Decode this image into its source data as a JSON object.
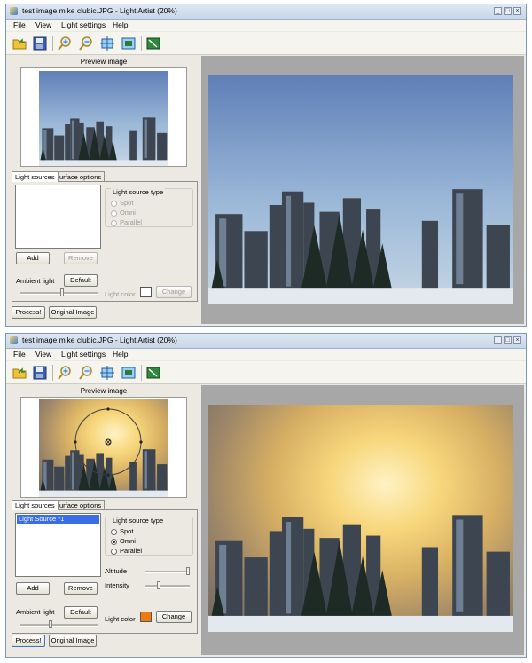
{
  "window1": {
    "title": "test image mike clubic.JPG - Light Artist (20%)",
    "menu": [
      "File",
      "View",
      "Light settings",
      "Help"
    ],
    "preview_label": "Preview image",
    "tabs": [
      "Light sources",
      "Surface options"
    ],
    "add_label": "Add",
    "remove_label": "Remove",
    "ambient_label": "Ambient light",
    "default_label": "Default",
    "ambient_level": 0.55,
    "light_type_title": "Light source type",
    "light_types": [
      "Spot",
      "Omni",
      "Parallel"
    ],
    "light_color_label": "Light color",
    "change_label": "Change",
    "light_color": "#ffffff",
    "process_label": "Process!",
    "original_label": "Original Image"
  },
  "window2": {
    "title": "test image mike clubic.JPG - Light Artist (20%)",
    "menu": [
      "File",
      "View",
      "Light settings",
      "Help"
    ],
    "preview_label": "Preview image",
    "tabs": [
      "Light sources",
      "Surface options"
    ],
    "list_item": "Light Source *1",
    "add_label": "Add",
    "remove_label": "Remove",
    "ambient_label": "Ambient light",
    "default_label": "Default",
    "ambient_level": 0.4,
    "light_type_title": "Light source type",
    "light_types": [
      "Spot",
      "Omni",
      "Parallel"
    ],
    "selected_type": "Omni",
    "altitude_label": "Altitude",
    "altitude_level": 0.95,
    "intensity_label": "Intensity",
    "intensity_level": 0.3,
    "light_color_label": "Light color",
    "change_label": "Change",
    "light_color": "#f07a10",
    "process_label": "Process!",
    "original_label": "Original Image"
  },
  "toolbar_icons": [
    "open-folder-icon",
    "save-icon",
    "zoom-in-icon",
    "zoom-out-icon",
    "fit-to-window-icon",
    "actual-size-icon",
    "export-image-icon"
  ],
  "colors": {
    "titlebar": "#c8d6e8",
    "window_bg": "#ece9e2",
    "viewer_bg": "#a7a7a7",
    "selection": "#3a6ee8"
  }
}
